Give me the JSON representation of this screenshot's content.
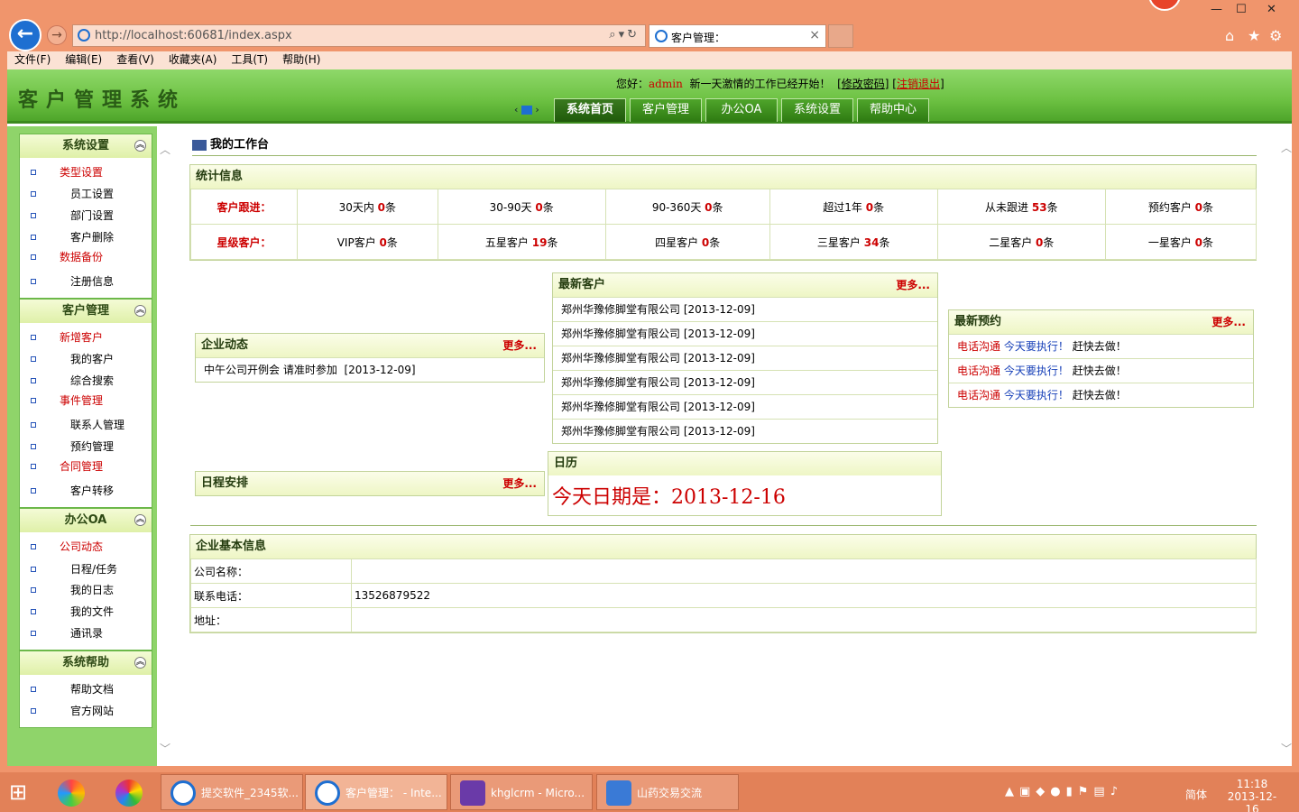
{
  "browser": {
    "url": "http://localhost:60681/index.aspx",
    "tab_title": "客户管理：",
    "menu": [
      "文件(F)",
      "编辑(E)",
      "查看(V)",
      "收藏夹(A)",
      "工具(T)",
      "帮助(H)"
    ]
  },
  "header": {
    "logo": "客户管理系统",
    "greet_prefix": "您好：",
    "user": "admin",
    "greet_suffix": "新一天激情的工作已经开始！",
    "change_pwd": "修改密码",
    "logout": "注销退出",
    "nav": [
      "系统首页",
      "客户管理",
      "办公OA",
      "系统设置",
      "帮助中心"
    ]
  },
  "sidebar": [
    {
      "title": "系统设置",
      "items": [
        {
          "label": "类型设置",
          "cat": true
        },
        {
          "label": "员工设置"
        },
        {
          "label": "部门设置"
        },
        {
          "label": "客户删除"
        },
        {
          "label": "数据备份",
          "cat": true
        },
        {
          "label": "注册信息"
        }
      ]
    },
    {
      "title": "客户管理",
      "items": [
        {
          "label": "新增客户",
          "cat": true
        },
        {
          "label": "我的客户"
        },
        {
          "label": "综合搜索"
        },
        {
          "label": "事件管理",
          "cat": true
        },
        {
          "label": "联系人管理"
        },
        {
          "label": "预约管理"
        },
        {
          "label": "合同管理",
          "cat": true
        },
        {
          "label": "客户转移"
        }
      ]
    },
    {
      "title": "办公OA",
      "items": [
        {
          "label": "公司动态",
          "cat": true
        },
        {
          "label": "日程/任务"
        },
        {
          "label": "我的日志"
        },
        {
          "label": "我的文件"
        },
        {
          "label": "通讯录"
        }
      ]
    },
    {
      "title": "系统帮助",
      "items": [
        {
          "label": "帮助文档"
        },
        {
          "label": "官方网站"
        }
      ]
    }
  ],
  "workbench": {
    "title": "我的工作台",
    "stats_title": "统计信息",
    "follow_label": "客户跟进：",
    "follow": [
      {
        "label": "30天内",
        "count": "0",
        "unit": "条"
      },
      {
        "label": "30-90天",
        "count": "0",
        "unit": "条"
      },
      {
        "label": "90-360天",
        "count": "0",
        "unit": "条"
      },
      {
        "label": "超过1年",
        "count": "0",
        "unit": "条"
      },
      {
        "label": "从未跟进",
        "count": "53",
        "unit": "条"
      },
      {
        "label": "预约客户",
        "count": "0",
        "unit": "条"
      }
    ],
    "star_label": "星级客户：",
    "stars": [
      {
        "label": "VIP客户",
        "count": "0",
        "unit": "条"
      },
      {
        "label": "五星客户",
        "count": "19",
        "unit": "条"
      },
      {
        "label": "四星客户",
        "count": "0",
        "unit": "条"
      },
      {
        "label": "三星客户",
        "count": "34",
        "unit": "条"
      },
      {
        "label": "二星客户",
        "count": "0",
        "unit": "条"
      },
      {
        "label": "一星客户",
        "count": "0",
        "unit": "条"
      }
    ],
    "news": {
      "title": "企业动态",
      "more": "更多...",
      "items": [
        {
          "text": "中午公司开例会 请准时参加",
          "date": "[2013-12-09]"
        }
      ]
    },
    "schedule": {
      "title": "日程安排",
      "more": "更多..."
    },
    "latest_customers": {
      "title": "最新客户",
      "more": "更多...",
      "items": [
        {
          "name": "郑州华豫修脚堂有限公司",
          "date": "[2013-12-09]"
        },
        {
          "name": "郑州华豫修脚堂有限公司",
          "date": "[2013-12-09]"
        },
        {
          "name": "郑州华豫修脚堂有限公司",
          "date": "[2013-12-09]"
        },
        {
          "name": "郑州华豫修脚堂有限公司",
          "date": "[2013-12-09]"
        },
        {
          "name": "郑州华豫修脚堂有限公司",
          "date": "[2013-12-09]"
        },
        {
          "name": "郑州华豫修脚堂有限公司",
          "date": "[2013-12-09]"
        }
      ]
    },
    "calendar": {
      "title": "日历",
      "today": "今天日期是：2013-12-16"
    },
    "appointments": {
      "title": "最新预约",
      "more": "更多...",
      "items": [
        {
          "type": "电话沟通",
          "what": "今天要执行！",
          "note": "赶快去做！"
        },
        {
          "type": "电话沟通",
          "what": "今天要执行！",
          "note": "赶快去做！"
        },
        {
          "type": "电话沟通",
          "what": "今天要执行！",
          "note": "赶快去做！"
        }
      ]
    },
    "company": {
      "title": "企业基本信息",
      "rows": [
        {
          "k": "公司名称：",
          "v": ""
        },
        {
          "k": "联系电话：",
          "v": "13526879522"
        },
        {
          "k": "地址：",
          "v": ""
        }
      ]
    }
  },
  "taskbar": {
    "windows": [
      "提交软件_2345软...",
      "客户管理： - Inte...",
      "khglcrm - Micro...",
      "山药交易交流"
    ],
    "ime": "简体",
    "time": "11:18",
    "date": "2013-12-16"
  }
}
